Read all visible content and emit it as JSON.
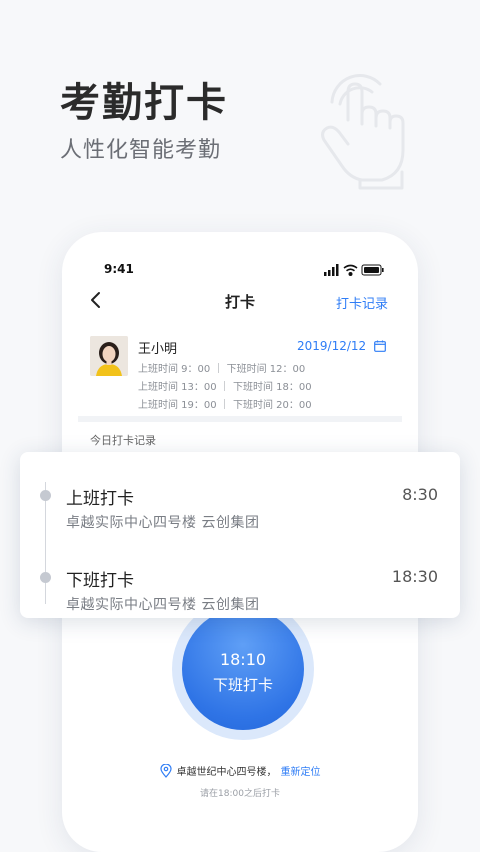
{
  "hero": {
    "title": "考勤打卡",
    "subtitle": "人性化智能考勤",
    "icon": "pointing-hand-icon"
  },
  "status_bar": {
    "time": "9:41",
    "icons": [
      "signal-icon",
      "wifi-icon",
      "battery-icon"
    ]
  },
  "nav": {
    "back_icon": "chevron-left-icon",
    "title": "打卡",
    "record_link": "打卡记录"
  },
  "profile": {
    "name": "王小明",
    "date": "2019/12/12",
    "date_icon": "calendar-icon",
    "shifts": [
      "上班时间 9：00 ｜ 下班时间 12：00",
      "上班时间 13：00 ｜ 下班时间 18：00",
      "上班时间 19：00 ｜ 下班时间 20：00"
    ]
  },
  "today": {
    "label": "今日打卡记录"
  },
  "records": [
    {
      "title": "上班打卡",
      "location": "卓越实际中心四号楼   云创集团",
      "time": "8:30"
    },
    {
      "title": "下班打卡",
      "location": "卓越实际中心四号楼   云创集团",
      "time": "18:30"
    }
  ],
  "clock_button": {
    "time": "18:10",
    "label": "下班打卡"
  },
  "location": {
    "text": "卓越世纪中心四号楼，",
    "relocate": "重新定位",
    "icon": "location-pin-icon"
  },
  "hint": "请在18:00之后打卡",
  "colors": {
    "accent": "#2f7df6",
    "button": "#2f74e6",
    "halo": "#dbe8fb"
  }
}
